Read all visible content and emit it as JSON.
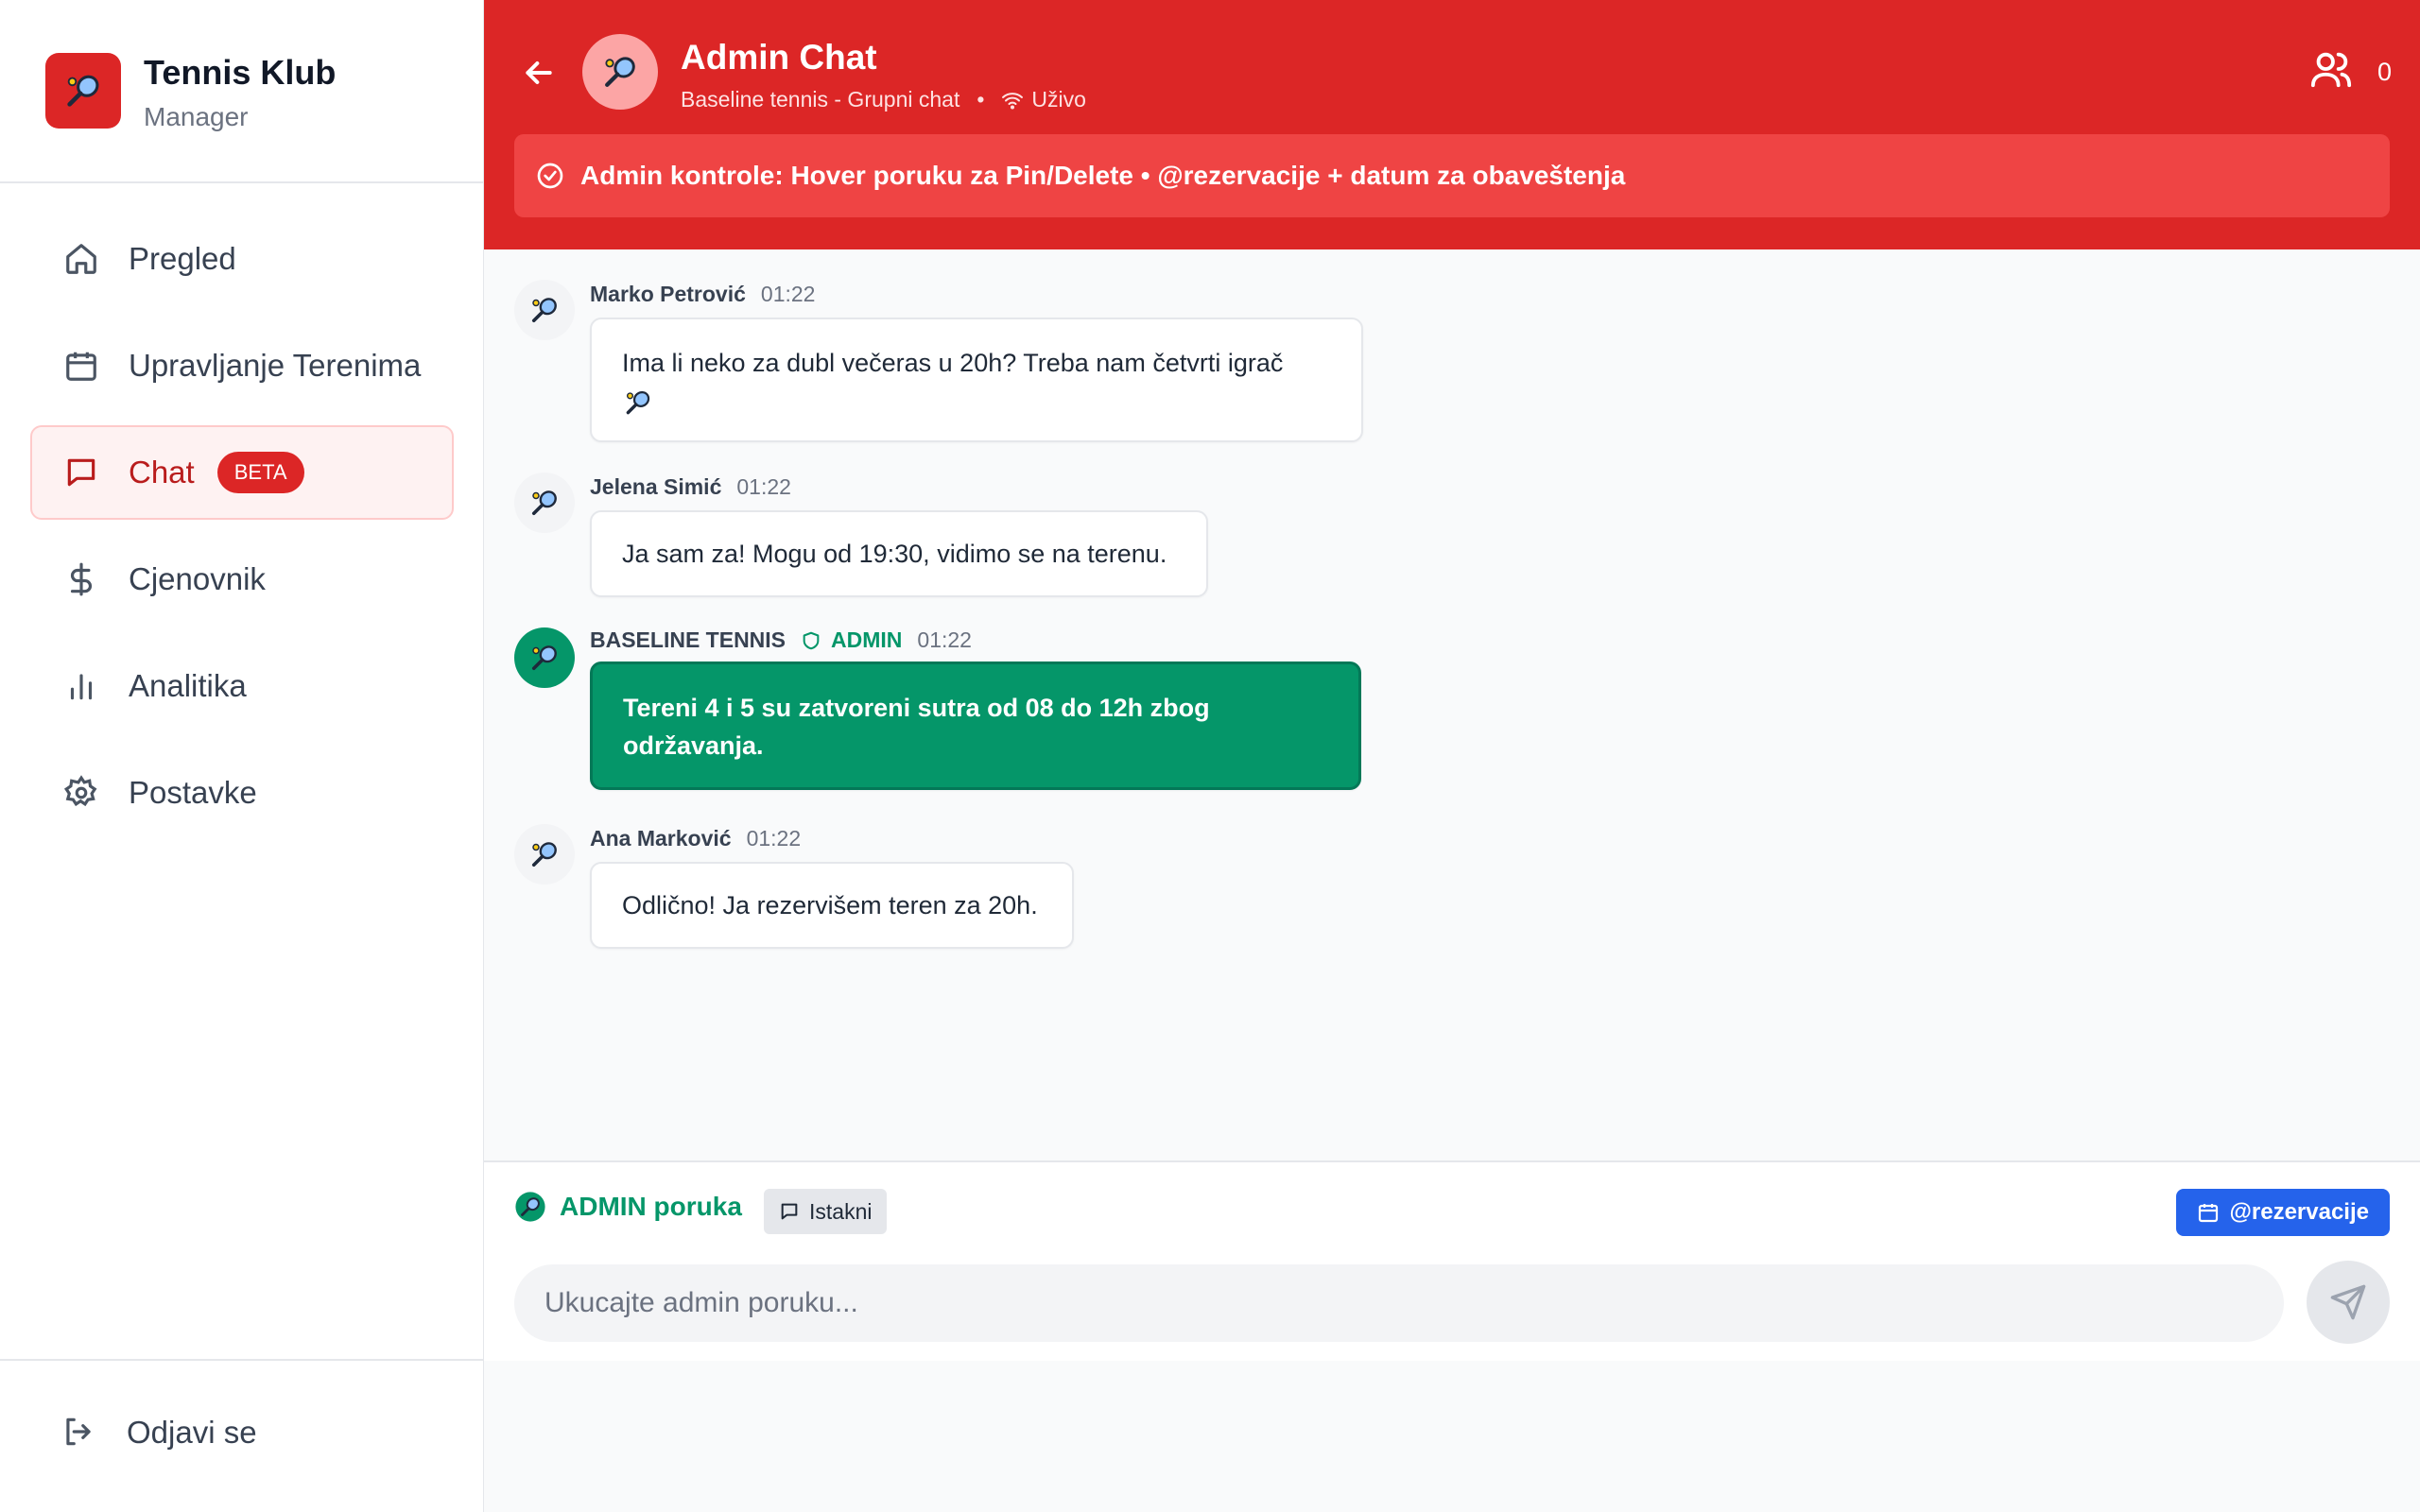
{
  "brand": {
    "title": "Tennis Klub",
    "subtitle": "Manager",
    "logo_icon": "tennis-racket-icon",
    "accent": "#dc2626"
  },
  "sidebar": {
    "items": [
      {
        "label": "Pregled",
        "icon": "home-icon"
      },
      {
        "label": "Upravljanje Terenima",
        "icon": "calendar-icon"
      },
      {
        "label": "Chat",
        "icon": "chat-bubble-icon",
        "badge": "BETA",
        "active": true
      },
      {
        "label": "Cjenovnik",
        "icon": "dollar-icon"
      },
      {
        "label": "Analitika",
        "icon": "bar-chart-icon"
      },
      {
        "label": "Postavke",
        "icon": "gear-icon"
      }
    ],
    "logout": {
      "label": "Odjavi se",
      "icon": "logout-icon"
    }
  },
  "header": {
    "title": "Admin Chat",
    "subtitle": "Baseline tennis - Grupni chat",
    "separator": "•",
    "status": "Uživo",
    "member_count": "0",
    "banner": "Admin kontrole: Hover poruku za Pin/Delete • @rezervacije + datum za obaveštenja"
  },
  "messages": [
    {
      "author": "Marko Petrović",
      "time": "01:22",
      "text": "Ima li neko za dubl večeras u 20h? Treba nam četvrti igrač",
      "emoji": "tennis-racket-icon",
      "admin": false
    },
    {
      "author": "Jelena Simić",
      "time": "01:22",
      "text": "Ja sam za! Mogu od 19:30, vidimo se na terenu.",
      "admin": false
    },
    {
      "author": "BASELINE TENNIS",
      "role": "ADMIN",
      "time": "01:22",
      "text": "Tereni 4 i 5 su zatvoreni sutra od 08 do 12h zbog održavanja.",
      "admin": true
    },
    {
      "author": "Ana Marković",
      "time": "01:22",
      "text": "Odlično! Ja rezervišem teren za 20h.",
      "admin": false
    }
  ],
  "composer": {
    "mode_label": "ADMIN poruka",
    "highlight_label": "Istakni",
    "reservations_label": "@rezervacije",
    "placeholder": "Ukucajte admin poruku..."
  },
  "colors": {
    "header_bg": "#dc2626",
    "admin_green": "#059669",
    "button_blue": "#2563eb"
  }
}
